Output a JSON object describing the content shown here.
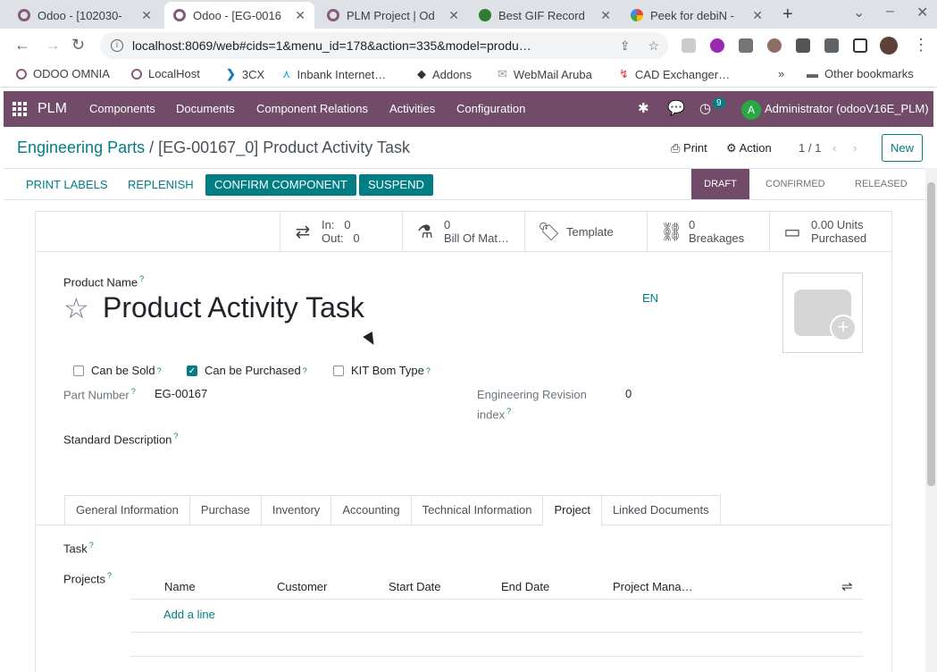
{
  "browser": {
    "tabs": [
      {
        "title": "Odoo - [102030-",
        "active": false,
        "icon": "odoo-icon"
      },
      {
        "title": "Odoo - [EG-0016",
        "active": true,
        "icon": "odoo-icon"
      },
      {
        "title": "PLM Project | Od",
        "active": false,
        "icon": "odoo-icon"
      },
      {
        "title": "Best GIF Record",
        "active": false,
        "icon": "gif-icon"
      },
      {
        "title": "Peek for debiN -",
        "active": false,
        "icon": "google-icon"
      }
    ],
    "url": "localhost:8069/web#cids=1&menu_id=178&action=335&model=produ…",
    "bookmarks": [
      {
        "label": "ODOO OMNIA",
        "icon": "odoo-icon"
      },
      {
        "label": "LocalHost",
        "icon": "odoo-icon"
      },
      {
        "label": "3CX",
        "icon": "3cx-icon"
      },
      {
        "label": "Inbank Internet…",
        "icon": "inbank-icon"
      },
      {
        "label": "Addons",
        "icon": "addons-icon"
      },
      {
        "label": "WebMail Aruba",
        "icon": "mail-icon"
      },
      {
        "label": "CAD Exchanger…",
        "icon": "cad-icon"
      }
    ],
    "other_bookmarks": "Other bookmarks"
  },
  "navbar": {
    "app": "PLM",
    "menus": [
      "Components",
      "Documents",
      "Component Relations",
      "Activities",
      "Configuration"
    ],
    "activity_count": "9",
    "avatar_letter": "A",
    "user": "Administrator (odooV16E_PLM)"
  },
  "control": {
    "breadcrumb_parent": "Engineering Parts",
    "breadcrumb_sep": "/",
    "breadcrumb_current": "[EG-00167_0] Product Activity Task",
    "print": "Print",
    "action": "Action",
    "pager": "1 / 1",
    "new": "New"
  },
  "header_buttons": {
    "print_labels": "PRINT LABELS",
    "replenish": "REPLENISH",
    "confirm": "CONFIRM COMPONENT",
    "suspend": "SUSPEND"
  },
  "stages": [
    "DRAFT",
    "CONFIRMED",
    "RELEASED"
  ],
  "current_stage": "DRAFT",
  "smart_buttons": {
    "in_label": "In:",
    "in_value": "0",
    "out_label": "Out:",
    "out_value": "0",
    "bom_count": "0",
    "bom_label": "Bill Of Mat…",
    "template": "Template",
    "breakages_count": "0",
    "breakages_label": "Breakages",
    "purchased_value": "0.00 Units",
    "purchased_label": "Purchased"
  },
  "form": {
    "product_name_label": "Product Name",
    "product_name": "Product Activity Task",
    "lang": "EN",
    "can_be_sold": "Can be Sold",
    "can_be_sold_checked": false,
    "can_be_purchased": "Can be Purchased",
    "can_be_purchased_checked": true,
    "kit_bom": "KIT Bom Type",
    "kit_bom_checked": false,
    "part_number_label": "Part Number",
    "part_number": "EG-00167",
    "revision_label_1": "Engineering Revision",
    "revision_label_2": "index",
    "revision_value": "0",
    "std_desc_label": "Standard Description",
    "help": "?"
  },
  "form_tabs": [
    "General Information",
    "Purchase",
    "Inventory",
    "Accounting",
    "Technical Information",
    "Project",
    "Linked Documents"
  ],
  "active_tab": "Project",
  "project_tab": {
    "task_label": "Task",
    "projects_label": "Projects",
    "columns": [
      "Name",
      "Customer",
      "Start Date",
      "End Date",
      "Project Mana…"
    ],
    "add_line": "Add a line"
  }
}
